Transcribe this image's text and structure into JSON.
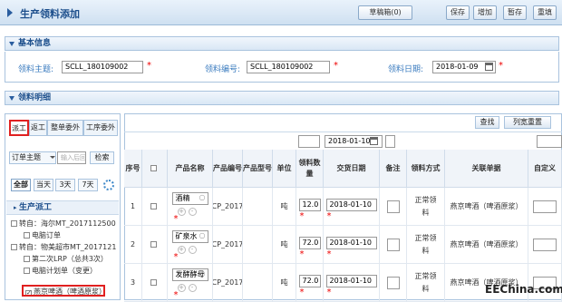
{
  "header": {
    "title": "生产领料添加",
    "buttons": [
      "草稿箱(0)",
      "保存",
      "增加",
      "暂存",
      "重填"
    ]
  },
  "basic": {
    "section": "基本信息",
    "subject_label": "领料主题:",
    "subject_value": "SCLL_180109002",
    "code_label": "领料编号:",
    "code_value": "SCLL_180109002",
    "date_label": "领料日期:",
    "date_value": "2018-01-09"
  },
  "detail": {
    "section": "领料明细"
  },
  "left": {
    "tabs": [
      "派工",
      "返工",
      "整单委外",
      "工序委外"
    ],
    "filter_select": "订单主题",
    "filter_placeholder": "输入后回",
    "search_btn": "检索",
    "range_tabs": [
      "全部",
      "当天",
      "3天",
      "7天"
    ],
    "group_title": "生产派工",
    "tree": [
      "转自：海尔MT_2017112500",
      "电脑订单",
      "转自：物美超市MT_2017121",
      "第二次LRP（总共3次）",
      "电脑计划单（变更）",
      "燕京啤酒（啤酒原浆）"
    ]
  },
  "grid": {
    "buttons": [
      "查找",
      "列宽重置"
    ],
    "filter_date": "2018-01-10",
    "headers": [
      "序号",
      "",
      "产品名称",
      "产品编号",
      "产品型号",
      "单位",
      "领料数量",
      "交货日期",
      "备注",
      "领料方式",
      "关联单据",
      "自定义"
    ],
    "rows": [
      {
        "no": "1",
        "name": "酒精",
        "code": "CP_2017",
        "unit": "吨",
        "qty": "12.0",
        "date": "2018-01-10",
        "method": "正常领料",
        "ref": "燕京啤酒（啤酒原浆）"
      },
      {
        "no": "2",
        "name": "矿泉水",
        "code": "CP_2017",
        "unit": "吨",
        "qty": "72.0",
        "date": "2018-01-10",
        "method": "正常领料",
        "ref": "燕京啤酒（啤酒原浆）"
      },
      {
        "no": "3",
        "name": "发酵酵母",
        "code": "CP_2017",
        "unit": "吨",
        "qty": "72.0",
        "date": "2018-01-10",
        "method": "正常领料",
        "ref": "燕京啤酒（啤酒原浆）"
      }
    ]
  },
  "watermark": "EEChina.com",
  "colors": {
    "accent": "#1d4f8c",
    "highlight": "#e02020"
  }
}
